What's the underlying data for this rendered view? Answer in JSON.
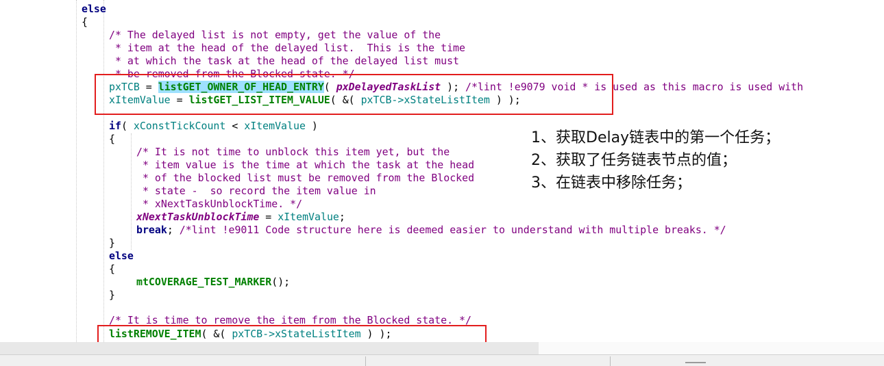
{
  "code": {
    "l00": {
      "kw": "else"
    },
    "l01": {
      "pn": "{"
    },
    "l02": {
      "cm": "/* The delayed list is not empty, get the value of the"
    },
    "l03": {
      "cm": " * item at the head of the delayed list.  This is the time"
    },
    "l04": {
      "cm": " * at which the task at the head of the delayed list must"
    },
    "l05": {
      "cm": " * be removed from the Blocked state. */"
    },
    "l06": {
      "var": "pxTCB",
      "op": " = ",
      "fn": "listGET_OWNER_OF_HEAD_ENTRY",
      "open": "( ",
      "arg": "pxDelayedTaskList",
      "close": " ); ",
      "cm": "/*lint !e9079 void * is used as this macro is used with"
    },
    "l07": {
      "var": "xItemValue",
      "op": " = ",
      "fn": "listGET_LIST_ITEM_VALUE",
      "open": "( &( ",
      "arg": "pxTCB->xStateListItem",
      "close": " ) );"
    },
    "l08": {
      "kw": "if",
      "open": "( ",
      "a": "xConstTickCount",
      "op": " < ",
      "b": "xItemValue",
      "close": " )"
    },
    "l09": {
      "pn": "{"
    },
    "l10": {
      "cm": "/* It is not time to unblock this item yet, but the"
    },
    "l11": {
      "cm": " * item value is the time at which the task at the head"
    },
    "l12": {
      "cm": " * of the blocked list must be removed from the Blocked"
    },
    "l13": {
      "cm": " * state -  so record the item value in"
    },
    "l14": {
      "cm": " * xNextTaskUnblockTime. */"
    },
    "l15": {
      "gv": "xNextTaskUnblockTime",
      "op": " = ",
      "var": "xItemValue",
      "end": ";"
    },
    "l16": {
      "kw": "break",
      "end": "; ",
      "cm": "/*lint !e9011 Code structure here is deemed easier to understand with multiple breaks. */"
    },
    "l17": {
      "pn": "}"
    },
    "l18": {
      "kw": "else"
    },
    "l19": {
      "pn": "{"
    },
    "l20": {
      "fn": "mtCOVERAGE_TEST_MARKER",
      "end": "();"
    },
    "l21": {
      "pn": "}"
    },
    "l22": {
      "cm": "/* It is time to remove the item from the Blocked state. */"
    },
    "l23": {
      "fn": "listREMOVE_ITEM",
      "open": "( &( ",
      "arg": "pxTCB->xStateListItem",
      "close": " ) );"
    }
  },
  "annotations": [
    "1、获取Delay链表中的第一个任务；",
    "2、获取了任务链表节点的值；",
    "3、在链表中移除任务；"
  ],
  "colors": {
    "keyword": "#000080",
    "comment": "#800080",
    "identifier": "#008080",
    "function": "#008000",
    "highlight": "#9ee0ff",
    "annotation_box": "#e21d1d"
  }
}
